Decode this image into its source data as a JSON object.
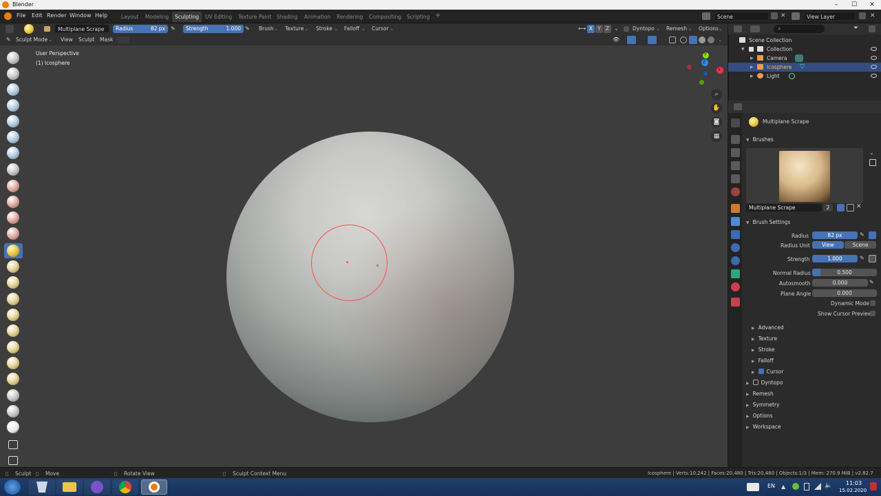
{
  "window": {
    "title": "Blender",
    "controls": [
      "–",
      "☐",
      "✕"
    ]
  },
  "topbar": {
    "menus": [
      "File",
      "Edit",
      "Render",
      "Window",
      "Help"
    ],
    "workspaces": [
      "Layout",
      "Modeling",
      "Sculpting",
      "UV Editing",
      "Texture Paint",
      "Shading",
      "Animation",
      "Rendering",
      "Compositing",
      "Scripting"
    ],
    "active_workspace": "Sculpting",
    "add_workspace": "+",
    "scene": "Scene",
    "view_layer": "View Layer"
  },
  "toolheader": {
    "brush_name": "Multiplane Scrape",
    "radius_label": "Radius",
    "radius_value": "82 px",
    "strength_label": "Strength",
    "strength_value": "1.000",
    "menus": [
      "Brush",
      "Texture",
      "Stroke",
      "Falloff",
      "Cursor"
    ],
    "axes": [
      "X",
      "Y",
      "Z"
    ],
    "dyntopo": "Dyntopo",
    "remesh": "Remesh",
    "options": "Options"
  },
  "modeheader": {
    "mode": "Sculpt Mode",
    "menus": [
      "View",
      "Sculpt",
      "Mask"
    ]
  },
  "viewport": {
    "perspective": "User Perspective",
    "object": "(1) Icosphere",
    "gizmo": {
      "x": "X",
      "y": "Y",
      "z": "Z"
    }
  },
  "outliner": {
    "root": "Scene Collection",
    "items": [
      {
        "label": "Collection",
        "indent": 1
      },
      {
        "label": "Camera",
        "indent": 2
      },
      {
        "label": "Icosphere",
        "indent": 2,
        "selected": true
      },
      {
        "label": "Light",
        "indent": 2
      }
    ]
  },
  "properties": {
    "brush_title": "Multiplane Scrape",
    "brushes_section": "Brushes",
    "brush_field": "Multiplane Scrape",
    "brush_users": "2",
    "brush_settings_section": "Brush Settings",
    "radius_label": "Radius",
    "radius_value": "82 px",
    "radius_unit_label": "Radius Unit",
    "radius_unit_view": "View",
    "radius_unit_scene": "Scene",
    "strength_label": "Strength",
    "strength_value": "1.000",
    "normal_radius_label": "Normal Radius",
    "normal_radius_value": "0.500",
    "normal_radius_fraction": 0.5,
    "autosmooth_label": "Autosmooth",
    "autosmooth_value": "0.000",
    "plane_angle_label": "Plane Angle",
    "plane_angle_value": "0.000",
    "dynamic_mode_label": "Dynamic Mode",
    "show_cursor_preview_label": "Show Cursor Preview",
    "subsections": [
      "Advanced",
      "Texture",
      "Stroke",
      "Falloff",
      "Cursor"
    ],
    "sections": [
      "Dyntopo",
      "Remesh",
      "Symmetry",
      "Options",
      "Workspace"
    ]
  },
  "statusbar": {
    "sculpt": "Sculpt",
    "move": "Move",
    "rotate_view": "Rotate View",
    "context_menu": "Sculpt Context Menu",
    "stats": "Icosphere | Verts:10,242 | Faces:20,480 | Tris:20,480 | Objects:1/3 | Mem: 270.9 MiB | v2.82.7"
  },
  "taskbar": {
    "lang": "EN",
    "time": "11:03",
    "date": "15.02.2020"
  },
  "colors": {
    "accent": "#4772b3",
    "brush_circle": "#ff4f4f",
    "viewport_bg": "#3d3d3d",
    "blender_orange": "#e87d0d"
  }
}
